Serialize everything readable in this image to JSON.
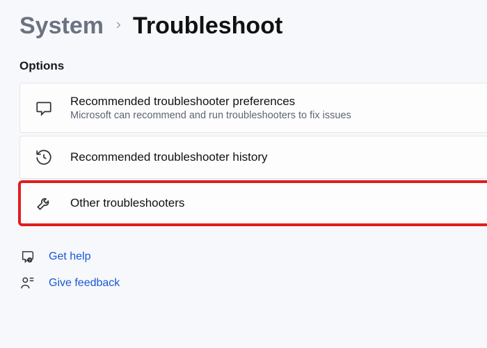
{
  "breadcrumb": {
    "parent": "System",
    "current": "Troubleshoot"
  },
  "section_label": "Options",
  "cards": [
    {
      "title": "Recommended troubleshooter preferences",
      "subtitle": "Microsoft can recommend and run troubleshooters to fix issues"
    },
    {
      "title": "Recommended troubleshooter history"
    },
    {
      "title": "Other troubleshooters"
    }
  ],
  "links": {
    "help": "Get help",
    "feedback": "Give feedback"
  }
}
